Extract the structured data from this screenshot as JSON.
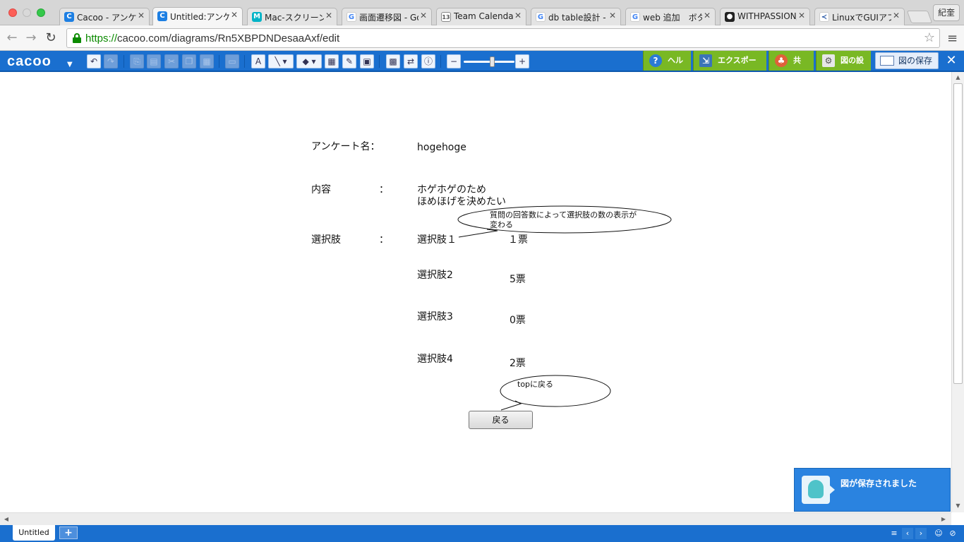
{
  "browser": {
    "tabs": [
      {
        "label": "Cacoo - アンケ…",
        "favicon": "cacoo-icon",
        "color": "#1d7fe3"
      },
      {
        "label": "Untitled:アンケ…",
        "favicon": "cacoo-icon",
        "color": "#1d7fe3",
        "active": true
      },
      {
        "label": "Mac-スクリーン…",
        "favicon": "mac-icon",
        "color": "#00b3c7"
      },
      {
        "label": "画面遷移図 - Goo…",
        "favicon": "google-icon",
        "color": "#4285f4"
      },
      {
        "label": "Team Calendar…",
        "favicon": "calendar-icon",
        "color": "#888888"
      },
      {
        "label": "db table設計 - G…",
        "favicon": "google-icon",
        "color": "#4285f4"
      },
      {
        "label": "web 追加　ボタ…",
        "favicon": "google-icon",
        "color": "#4285f4"
      },
      {
        "label": "WITHPASSION/…",
        "favicon": "github-icon",
        "color": "#222222"
      },
      {
        "label": "LinuxでGUIアプ…",
        "favicon": "linux-icon",
        "color": "#2a5aa8"
      }
    ],
    "profile_label": "紀奎",
    "url_protocol": "https://",
    "url_rest": "cacoo.com/diagrams/Rn5XBPDNDesaaAxf/edit"
  },
  "toolbar": {
    "logo": "cacoo",
    "help_label": "ヘルプ",
    "export_label": "エクスポート",
    "share_label": "共有",
    "diagram_settings_label": "図の設定",
    "save_label": "図の保存",
    "accent_color": "#1a6fcf",
    "green_color": "#79b824"
  },
  "canvas": {
    "survey_name_label": "アンケート名：",
    "survey_name_value": "hogehoge",
    "content_label": "内容",
    "content_colon": "：",
    "content_line1": "ホゲホゲのため",
    "content_line2": "ほめほげを決めたい",
    "options_label": "選択肢",
    "options_colon": "：",
    "options": [
      {
        "name": "選択肢１",
        "votes": "１票"
      },
      {
        "name": "選択肢2",
        "votes": "5票"
      },
      {
        "name": "選択肢3",
        "votes": "0票"
      },
      {
        "name": "選択肢4",
        "votes": "2票"
      }
    ],
    "callout_options": "質問の回答数によって選択肢の数の表示が変わる",
    "callout_back": "topに戻る",
    "back_button": "戻る"
  },
  "sheet": {
    "tab_label": "Untitled",
    "add_label": "+"
  },
  "toast": {
    "message": "図が保存されました"
  }
}
